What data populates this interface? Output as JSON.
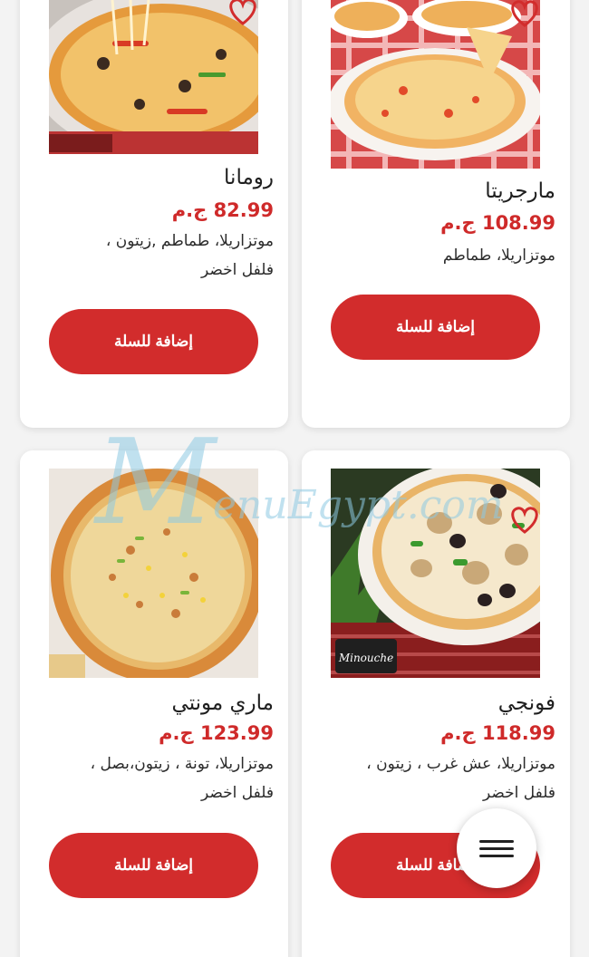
{
  "products": [
    {
      "name": "رومانا",
      "price": "82.99 ج.م",
      "description": "موتزاريلا، طماطم ,زيتون ، فلفل اخضر",
      "add_label": "إضافة للسلة",
      "image_icon": "pizza-photo"
    },
    {
      "name": "مارجريتا",
      "price": "108.99 ج.م",
      "description": "موتزاريلا، طماطم",
      "add_label": "إضافة للسلة",
      "image_icon": "pizza-photo"
    },
    {
      "name": "ماري مونتي",
      "price": "123.99 ج.م",
      "description": "موتزاريلا، تونة ، زيتون،بصل ، فلفل اخضر",
      "add_label": "إضافة للسلة",
      "image_icon": "pizza-photo"
    },
    {
      "name": "فونجي",
      "price": "118.99 ج.م",
      "description": "موتزاريلا، عش غرب ، زيتون ، فلفل اخضر",
      "add_label": "إضافة للسلة",
      "image_icon": "pizza-photo"
    }
  ],
  "watermark": {
    "letter": "M",
    "text": "enuEgypt.com"
  },
  "menu_fab": {
    "icon": "hamburger-menu-icon"
  },
  "colors": {
    "accent": "#d22c2c",
    "price": "#cf2a2a",
    "card": "#ffffff",
    "background": "#f3f3f3"
  }
}
